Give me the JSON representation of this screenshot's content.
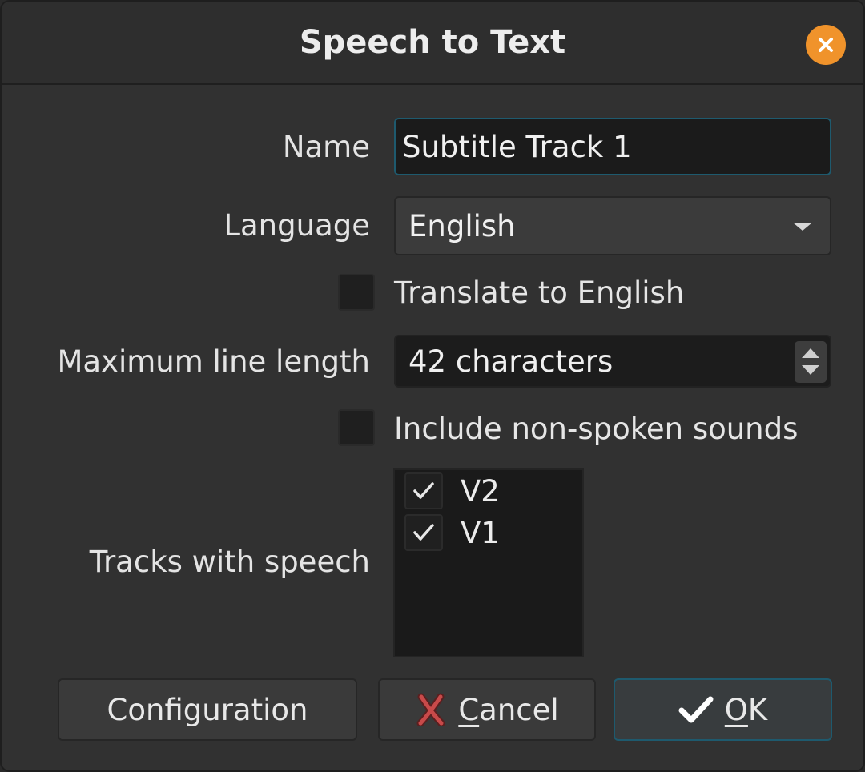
{
  "dialog": {
    "title": "Speech to Text"
  },
  "form": {
    "name_label": "Name",
    "name_value": "Subtitle Track 1",
    "language_label": "Language",
    "language_value": "English",
    "translate_label": "Translate to English",
    "translate_checked": false,
    "max_line_label": "Maximum line length",
    "max_line_value": "42 characters",
    "nonspoken_label": "Include non-spoken sounds",
    "nonspoken_checked": false,
    "tracks_label": "Tracks with speech",
    "tracks": [
      {
        "label": "V2",
        "checked": true
      },
      {
        "label": "V1",
        "checked": true
      }
    ]
  },
  "buttons": {
    "configuration": "Configuration",
    "cancel_first": "C",
    "cancel_rest": "ancel",
    "ok_first": "O",
    "ok_rest": "K"
  },
  "icons": {
    "close": "close-icon",
    "cancel": "cancel-x-icon",
    "ok": "checkmark-icon"
  },
  "colors": {
    "accent": "#f0932b",
    "focus_border": "#1e5a6e",
    "cancel_icon": "#c84a4a"
  }
}
